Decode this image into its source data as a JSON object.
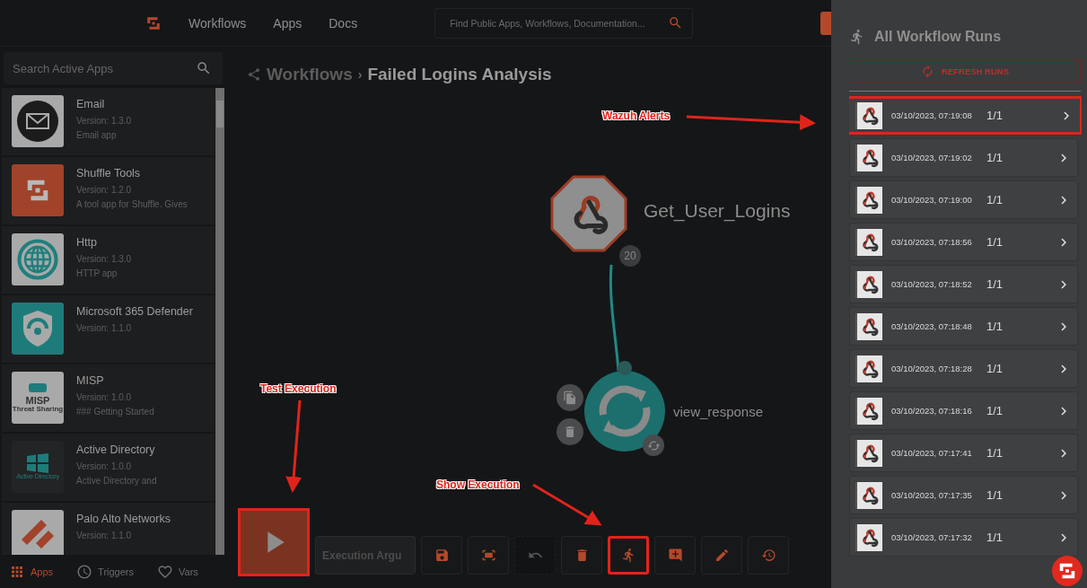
{
  "top_bar": {
    "nav": [
      "Workflows",
      "Apps",
      "Docs"
    ],
    "search": {
      "placeholder": "Find Public Apps, Workflows, Documentation..."
    }
  },
  "sidebar": {
    "search": {
      "placeholder": "Search Active Apps"
    },
    "apps": [
      {
        "name": "Email",
        "version": "Version: 1.3.0",
        "description": "Email app"
      },
      {
        "name": "Shuffle Tools",
        "version": "Version: 1.2.0",
        "description": "A tool app for Shuffle. Gives"
      },
      {
        "name": "Http",
        "version": "Version: 1.3.0",
        "description": "HTTP app"
      },
      {
        "name": "Microsoft 365 Defender",
        "version": "Version: 1.1.0"
      },
      {
        "logo_text": "MISP",
        "logo_subtext": "Threat Sharing",
        "name": "MISP",
        "version": "Version: 1.0.0",
        "description": "### Getting Started"
      },
      {
        "logo_text": "Active Directory",
        "name": "Active Directory",
        "version": "Version: 1.0.0",
        "description": "Active Directory and"
      },
      {
        "name": "Palo Alto Networks",
        "version": "Version: 1.1.0"
      }
    ],
    "tabs": [
      {
        "kind": "apps",
        "label": "Apps",
        "selected": true
      },
      {
        "kind": "triggers",
        "label": "Triggers",
        "selected": false
      },
      {
        "kind": "vars",
        "label": "Vars",
        "selected": false
      }
    ]
  },
  "breadcrumb": {
    "parent": "Workflows",
    "separator": "›",
    "current": "Failed Logins Analysis"
  },
  "canvas": {
    "nodes": [
      {
        "kind": "webhook",
        "label": "Get_User_Logins",
        "badge": "20"
      },
      {
        "kind": "app",
        "label": "view_response"
      }
    ]
  },
  "toolbar": {
    "run_button": {
      "highlighted": true
    },
    "execution_argument": {
      "placeholder": "Execution Argu"
    },
    "buttons": [
      {
        "kind": "save",
        "disabled": false,
        "highlighted": false
      },
      {
        "kind": "fit",
        "disabled": false,
        "highlighted": false
      },
      {
        "kind": "undo",
        "disabled": true,
        "highlighted": false
      },
      {
        "kind": "delete",
        "disabled": false,
        "highlighted": false
      },
      {
        "kind": "executions",
        "disabled": false,
        "highlighted": true
      },
      {
        "kind": "comment",
        "disabled": false,
        "highlighted": false
      },
      {
        "kind": "edit",
        "disabled": false,
        "highlighted": false
      },
      {
        "kind": "history",
        "disabled": false,
        "highlighted": false
      }
    ]
  },
  "runs_panel": {
    "title": "All Workflow Runs",
    "refresh_button": "REFRESH RUNS",
    "runs": [
      {
        "timestamp": "03/10/2023, 07:19:08",
        "count": "1/1",
        "highlighted": true
      },
      {
        "timestamp": "03/10/2023, 07:19:02",
        "count": "1/1",
        "highlighted": false
      },
      {
        "timestamp": "03/10/2023, 07:19:00",
        "count": "1/1",
        "highlighted": false
      },
      {
        "timestamp": "03/10/2023, 07:18:56",
        "count": "1/1",
        "highlighted": false
      },
      {
        "timestamp": "03/10/2023, 07:18:52",
        "count": "1/1",
        "highlighted": false
      },
      {
        "timestamp": "03/10/2023, 07:18:48",
        "count": "1/1",
        "highlighted": false
      },
      {
        "timestamp": "03/10/2023, 07:18:28",
        "count": "1/1",
        "highlighted": false
      },
      {
        "timestamp": "03/10/2023, 07:18:16",
        "count": "1/1",
        "highlighted": false
      },
      {
        "timestamp": "03/10/2023, 07:17:41",
        "count": "1/1",
        "highlighted": false
      },
      {
        "timestamp": "03/10/2023, 07:17:35",
        "count": "1/1",
        "highlighted": false
      },
      {
        "timestamp": "03/10/2023, 07:17:32",
        "count": "1/1",
        "highlighted": false
      }
    ]
  },
  "annotations": [
    {
      "label": "Wazuh Alerts"
    },
    {
      "label": "Test Execution"
    },
    {
      "label": "Show Execution"
    }
  ]
}
